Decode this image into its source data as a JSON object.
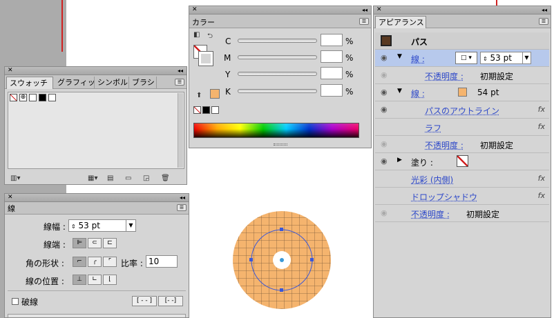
{
  "swatches": {
    "tabs": [
      "スウォッチ",
      "グラフィッ",
      "シンボル",
      "ブラシ"
    ]
  },
  "color": {
    "title": "カラー",
    "channels": [
      {
        "label": "C",
        "value": "",
        "unit": "%"
      },
      {
        "label": "M",
        "value": "",
        "unit": "%"
      },
      {
        "label": "Y",
        "value": "",
        "unit": "%"
      },
      {
        "label": "K",
        "value": "",
        "unit": "%"
      }
    ]
  },
  "stroke": {
    "title": "線",
    "weight_label": "線幅 :",
    "weight_value": "53 pt",
    "cap_label": "線端 :",
    "corner_label": "角の形状 :",
    "ratio_label": "比率 :",
    "ratio_value": "10",
    "align_label": "線の位置 :",
    "dash_label": "破線"
  },
  "appearance": {
    "title": "アピアランス",
    "object": "パス",
    "stroke1_label": "線 :",
    "stroke1_value": "53 pt",
    "opacity_label": "不透明度 :",
    "opacity_value": "初期設定",
    "stroke2_label": "線 :",
    "stroke2_value": "54 pt",
    "outline_path": "パスのアウトライン",
    "roughen": "ラフ",
    "fill_label": "塗り :",
    "inner_glow": "光彩 (内側)",
    "drop_shadow": "ドロップシャドウ",
    "fx_label": "fx"
  },
  "colors": {
    "accent_fill": "#f5b46e",
    "selection": "#3a58d8",
    "row_highlight": "#b7c9ec"
  }
}
